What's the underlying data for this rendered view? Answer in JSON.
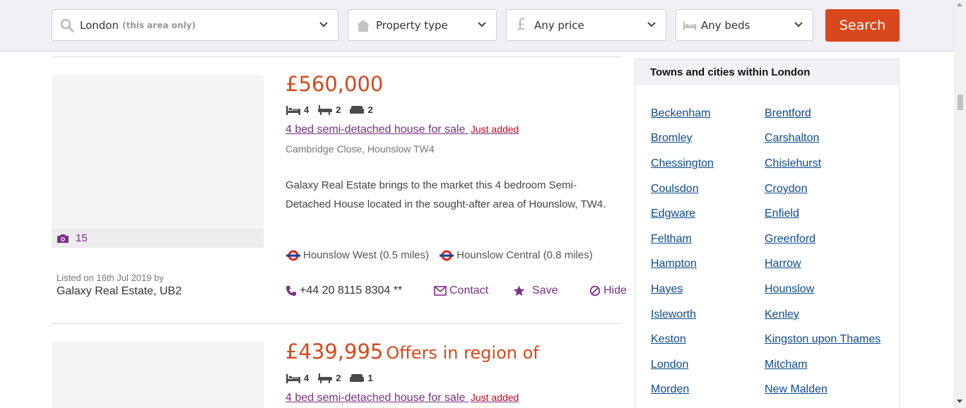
{
  "search_bar": {
    "location": "London",
    "location_hint": "(this area only)",
    "property_type": "Property type",
    "price": "Any price",
    "beds": "Any beds",
    "search_label": "Search"
  },
  "listings": [
    {
      "price": "£560,000",
      "price_qualifier": "",
      "beds": "4",
      "baths": "2",
      "receptions": "2",
      "title": "4 bed semi-detached house for sale",
      "badge": "Just added",
      "address": "Cambridge Close, Hounslow TW4",
      "description": "Galaxy Real Estate brings to the market this 4 bedroom Semi-Detached House located in the sought-after area of Hounslow, TW4.",
      "photo_count": "15",
      "stations": [
        {
          "name": "Hounslow West (0.5 miles)"
        },
        {
          "name": "Hounslow Central (0.8 miles)"
        }
      ],
      "listed_on": "Listed on 16th Jul 2019 by",
      "agent": "Galaxy Real Estate, UB2",
      "phone": "+44 20 8115 8304 **",
      "contact_label": "Contact",
      "save_label": "Save",
      "hide_label": "Hide"
    },
    {
      "price": "£439,995",
      "price_qualifier": "Offers in region of",
      "beds": "4",
      "baths": "2",
      "receptions": "1",
      "title": "4 bed semi-detached house for sale",
      "badge": "Just added"
    }
  ],
  "sidebar": {
    "heading": "Towns and cities within London",
    "towns": [
      "Beckenham",
      "Brentford",
      "Bromley",
      "Carshalton",
      "Chessington",
      "Chislehurst",
      "Coulsdon",
      "Croydon",
      "Edgware",
      "Enfield",
      "Feltham",
      "Greenford",
      "Hampton",
      "Harrow",
      "Hayes",
      "Hounslow",
      "Isleworth",
      "Kenley",
      "Keston",
      "Kingston upon Thames",
      "London",
      "Mitcham",
      "Morden",
      "New Malden"
    ]
  },
  "colors": {
    "accent": "#d9471d",
    "brand_purple": "#7b2f86",
    "link_blue": "#0c4b8e",
    "badge_red": "#d0021b"
  },
  "icons": [
    "search-icon",
    "house-icon",
    "pound-icon",
    "bed-icon",
    "chevron-down-icon",
    "bath-icon",
    "sofa-icon",
    "camera-icon",
    "underground-icon",
    "phone-icon",
    "envelope-icon",
    "star-icon",
    "hide-icon"
  ]
}
